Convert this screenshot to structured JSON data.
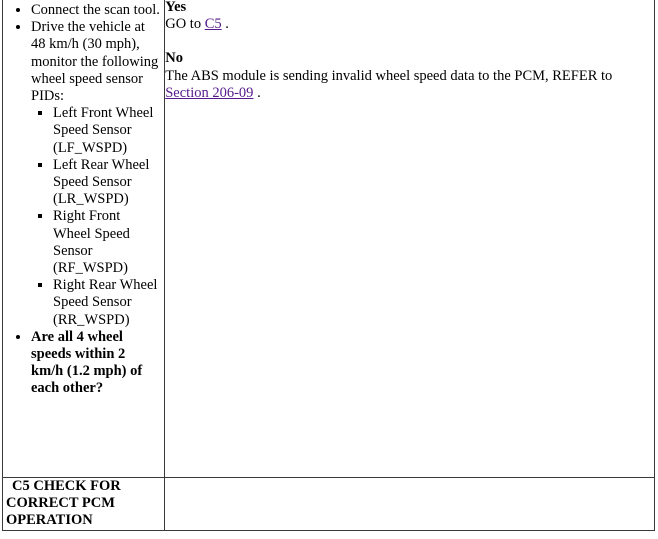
{
  "document": {
    "type": "diagnostic-procedure-table",
    "link_color": "#551A8B",
    "border_color": "#3A3A3A"
  },
  "table": {
    "rows": [
      {
        "left": {
          "steps": [
            {
              "text": "Connect the scan tool.",
              "bold": false,
              "substeps": []
            },
            {
              "text": "Drive the vehicle at 48 km/h (30 mph), monitor the following wheel speed sensor PIDs:",
              "bold": false,
              "substeps": [
                "Left Front Wheel Speed Sensor (LF_WSPD)",
                "Left Rear Wheel Speed Sensor (LR_WSPD)",
                "Right Front Wheel Speed Sensor (RF_WSPD)",
                "Right Rear Wheel Speed Sensor (RR_WSPD)"
              ]
            },
            {
              "text": "Are all 4 wheel speeds within 2 km/h (1.2 mph) of each other?",
              "bold": true,
              "substeps": []
            }
          ]
        },
        "right": {
          "answers": [
            {
              "head": "Yes",
              "pre": "GO to ",
              "link": "C5",
              "post": " ."
            },
            {
              "head": "No",
              "pre": "The ABS module is sending invalid wheel speed data to the PCM, REFER to ",
              "link": "Section 206-09",
              "post": " ."
            }
          ]
        }
      },
      {
        "left": {
          "step_title": "C5 CHECK FOR CORRECT PCM OPERATION"
        },
        "right": {
          "content": ""
        }
      }
    ]
  }
}
